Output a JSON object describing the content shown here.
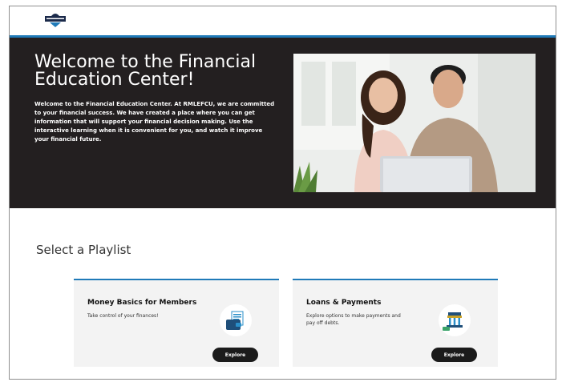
{
  "hero": {
    "title": "Welcome to the Financial Education Center!",
    "text": "Welcome to the Financial Education Center. At RMLEFCU, we are committed to your financial success. We have created a place where you can get information that will support your financial decision making. Use the interactive learning when it is convenient for you, and watch it improve your financial future."
  },
  "section": {
    "title": "Select a Playlist"
  },
  "playlists": [
    {
      "title": "Money Basics for Members",
      "description": "Take control of your finances!",
      "button": "Explore",
      "icon": "wallet-icon"
    },
    {
      "title": "Loans & Payments",
      "description": "Explore options to make payments and pay off debts.",
      "button": "Explore",
      "icon": "bank-icon"
    }
  ],
  "colors": {
    "accent": "#1f7ab8",
    "hero_bg": "#231f20",
    "card_bg": "#f3f3f3",
    "button_bg": "#1b1b1b"
  }
}
